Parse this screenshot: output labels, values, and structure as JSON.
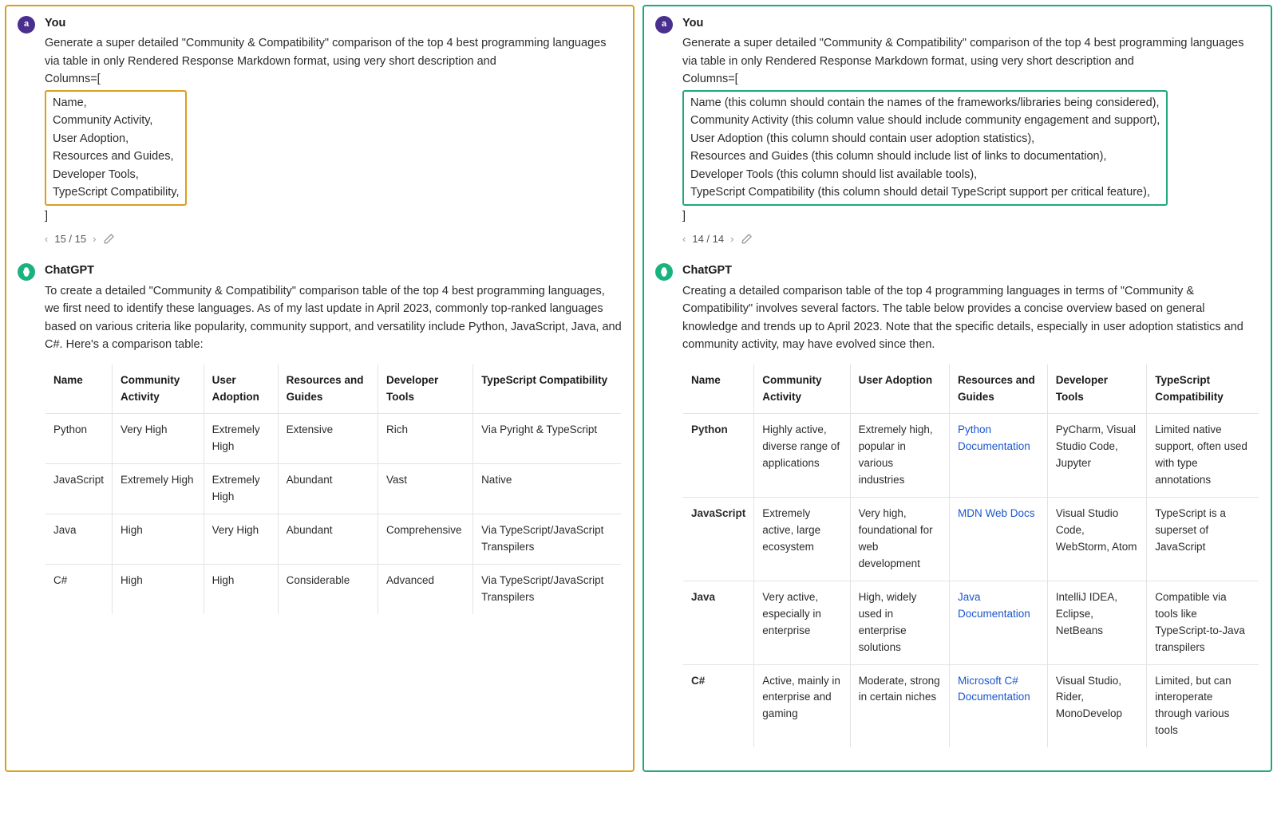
{
  "left": {
    "user": {
      "sender": "You",
      "avatar_letter": "a",
      "prompt_pre": "Generate a super detailed \"Community & Compatibility\" comparison of the top 4 best programming languages via table in only Rendered Response Markdown format, using very short description and",
      "columns_label": "Columns=[",
      "columns": [
        "Name,",
        "Community Activity,",
        "User Adoption,",
        "Resources and Guides,",
        "Developer Tools,",
        "TypeScript Compatibility,"
      ],
      "columns_close": "]",
      "pager": "15 / 15"
    },
    "assistant": {
      "sender": "ChatGPT",
      "intro": "To create a detailed \"Community & Compatibility\" comparison table of the top 4 best programming languages, we first need to identify these languages. As of my last update in April 2023, commonly top-ranked languages based on various criteria like popularity, community support, and versatility include Python, JavaScript, Java, and C#. Here's a comparison table:",
      "headers": [
        "Name",
        "Community Activity",
        "User Adoption",
        "Resources and Guides",
        "Developer Tools",
        "TypeScript Compatibility"
      ],
      "rows": [
        [
          "Python",
          "Very High",
          "Extremely High",
          "Extensive",
          "Rich",
          "Via Pyright & TypeScript"
        ],
        [
          "JavaScript",
          "Extremely High",
          "Extremely High",
          "Abundant",
          "Vast",
          "Native"
        ],
        [
          "Java",
          "High",
          "Very High",
          "Abundant",
          "Comprehensive",
          "Via TypeScript/JavaScript Transpilers"
        ],
        [
          "C#",
          "High",
          "High",
          "Considerable",
          "Advanced",
          "Via TypeScript/JavaScript Transpilers"
        ]
      ]
    }
  },
  "right": {
    "user": {
      "sender": "You",
      "avatar_letter": "a",
      "prompt_pre": "Generate a super detailed \"Community & Compatibility\" comparison of the top 4 best programming languages via table in only Rendered Response Markdown format, using very short description and",
      "columns_label": "Columns=[",
      "columns": [
        "Name (this column should contain the names of the frameworks/libraries being considered),",
        "Community Activity (this column value should include community engagement and support),",
        "User Adoption (this column should contain user adoption statistics),",
        "Resources and Guides (this column should include list of links to documentation),",
        "Developer Tools (this column should list available tools),",
        "TypeScript Compatibility (this column should detail TypeScript support per critical feature),"
      ],
      "columns_close": "]",
      "pager": "14 / 14"
    },
    "assistant": {
      "sender": "ChatGPT",
      "intro": "Creating a detailed comparison table of the top 4 programming languages in terms of \"Community & Compatibility\" involves several factors. The table below provides a concise overview based on general knowledge and trends up to April 2023. Note that the specific details, especially in user adoption statistics and community activity, may have evolved since then.",
      "headers": [
        "Name",
        "Community Activity",
        "User Adoption",
        "Resources and Guides",
        "Developer Tools",
        "TypeScript Compatibility"
      ],
      "rows": [
        {
          "name": "Python",
          "activity": "Highly active, diverse range of applications",
          "adoption": "Extremely high, popular in various industries",
          "resource": "Python Documentation",
          "tools": "PyCharm, Visual Studio Code, Jupyter",
          "ts": "Limited native support, often used with type annotations"
        },
        {
          "name": "JavaScript",
          "activity": "Extremely active, large ecosystem",
          "adoption": "Very high, foundational for web development",
          "resource": "MDN Web Docs",
          "tools": "Visual Studio Code, WebStorm, Atom",
          "ts": "TypeScript is a superset of JavaScript"
        },
        {
          "name": "Java",
          "activity": "Very active, especially in enterprise",
          "adoption": "High, widely used in enterprise solutions",
          "resource": "Java Documentation",
          "tools": "IntelliJ IDEA, Eclipse, NetBeans",
          "ts": "Compatible via tools like TypeScript-to-Java transpilers"
        },
        {
          "name": "C#",
          "activity": "Active, mainly in enterprise and gaming",
          "adoption": "Moderate, strong in certain niches",
          "resource": "Microsoft C# Documentation",
          "tools": "Visual Studio, Rider, MonoDevelop",
          "ts": "Limited, but can interoperate through various tools"
        }
      ]
    }
  }
}
